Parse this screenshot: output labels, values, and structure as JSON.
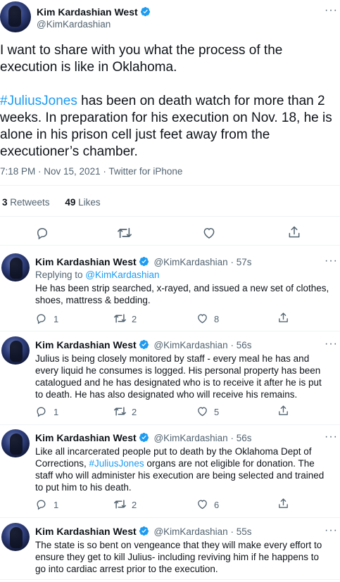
{
  "main_tweet": {
    "author_name": "Kim Kardashian West",
    "handle": "@KimKardashian",
    "text_p1": "I want to share with you what the process of the execution is like in Oklahoma.",
    "hashtag": "#JuliusJones",
    "text_p2_rest": " has been on death watch for more than 2 weeks. In preparation for his execution on Nov. 18, he is alone in his prison cell just feet away from the executioner’s chamber.",
    "timestamp": "7:18 PM · Nov 15, 2021 · Twitter for iPhone",
    "retweets_count": "3",
    "retweets_label": " Retweets",
    "likes_count": "49",
    "likes_label": " Likes"
  },
  "replies": [
    {
      "author_name": "Kim Kardashian West",
      "handle": "@KimKardashian",
      "time": " · 57s",
      "replying_to_label": "Replying to ",
      "replying_to_handle": "@KimKardashian",
      "text": "He has been strip searched, x-rayed, and issued a new set of clothes, shoes, mattress & bedding.",
      "replies": "1",
      "retweets": "2",
      "likes": "8"
    },
    {
      "author_name": "Kim Kardashian West",
      "handle": "@KimKardashian",
      "time": " · 56s",
      "text": "Julius is being closely monitored by staff - every meal he has and every liquid he consumes is logged. His personal property has been catalogued and he has designated who is to receive it after he is put to death. He has also designated who will receive his remains.",
      "replies": "1",
      "retweets": "2",
      "likes": "5"
    },
    {
      "author_name": "Kim Kardashian West",
      "handle": "@KimKardashian",
      "time": " · 56s",
      "text_before": "Like all incarcerated people put to death by the Oklahoma Dept of Corrections, ",
      "hashtag": "#JuliusJones",
      "text_after": " organs are not eligible for donation. The staff who will administer his execution are being selected and trained to put him to his death.",
      "replies": "1",
      "retweets": "2",
      "likes": "6"
    },
    {
      "author_name": "Kim Kardashian West",
      "handle": "@KimKardashian",
      "time": " · 55s",
      "text": "The state is so bent on vengeance that they will make every effort to ensure they get to kill Julius- including reviving him if he happens to go into cardiac arrest prior to the execution."
    }
  ],
  "colors": {
    "link": "#1d9bf0",
    "muted": "#536471",
    "text": "#0f1419",
    "divider": "#eff3f4"
  }
}
